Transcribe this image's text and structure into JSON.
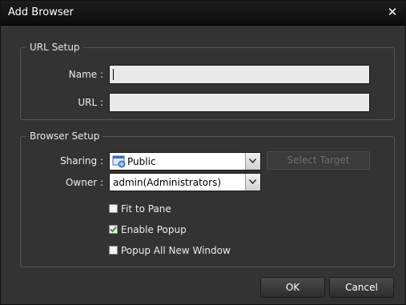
{
  "dialog": {
    "title": "Add Browser"
  },
  "url_setup": {
    "legend": "URL Setup",
    "name_label": "Name :",
    "name_value": "",
    "url_label": "URL :",
    "url_value": ""
  },
  "browser_setup": {
    "legend": "Browser Setup",
    "sharing_label": "Sharing :",
    "sharing_value": "Public",
    "sharing_icon": "public-icon",
    "select_target_label": "Select Target",
    "owner_label": "Owner :",
    "owner_value": "admin(Administrators)"
  },
  "options": [
    {
      "label": "Fit to Pane",
      "checked": false
    },
    {
      "label": "Enable Popup",
      "checked": true
    },
    {
      "label": "Popup All New Window",
      "checked": false
    }
  ],
  "buttons": {
    "ok": "OK",
    "cancel": "Cancel"
  },
  "colors": {
    "background": "#333333",
    "titlebar": "#111111",
    "check": "#2e9d1f"
  }
}
